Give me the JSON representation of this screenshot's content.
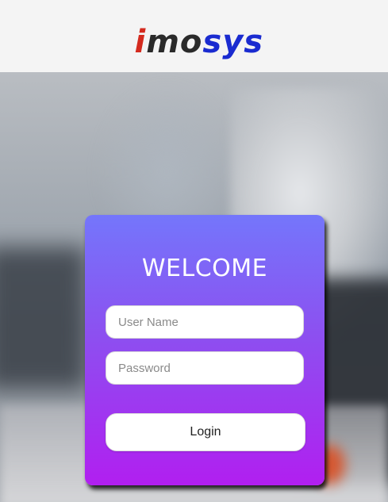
{
  "brand": {
    "logo_i": "i",
    "logo_mo": "mo",
    "logo_sys": "sys",
    "colors": {
      "red": "#d42a1e",
      "dark": "#2a2a2a",
      "blue": "#1a2bd0"
    }
  },
  "login": {
    "title": "WELCOME",
    "username_placeholder": "User Name",
    "password_placeholder": "Password",
    "button_label": "Login",
    "card_gradient": [
      "#7476fb",
      "#8d4ff0",
      "#b11ff0"
    ]
  }
}
